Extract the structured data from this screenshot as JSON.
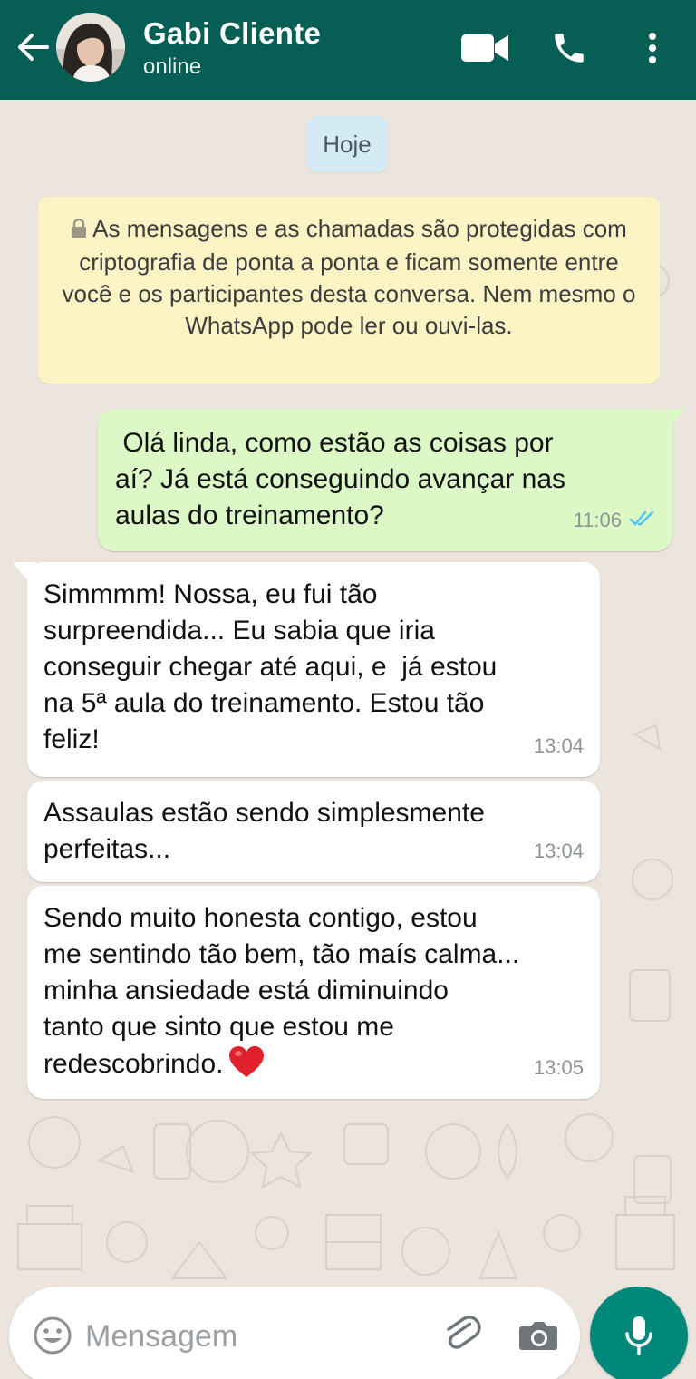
{
  "header": {
    "contact_name": "Gabi Cliente",
    "status": "online",
    "back_icon": "arrow-left-icon",
    "video_icon": "video-call-icon",
    "phone_icon": "phone-icon",
    "menu_icon": "more-vertical-icon",
    "background_color": "#075e54"
  },
  "chat": {
    "date_label": "Hoje",
    "encryption_notice": "As mensagens e as chamadas são protegidas com criptografia de ponta a ponta e ficam somente entre você e os participantes desta conversa. Nem mesmo o WhatsApp pode ler ou ouvi-las.",
    "messages": [
      {
        "direction": "outgoing",
        "text": " Olá linda, como estão as coisas por\naí? Já está conseguindo avançar nas\naulas do treinamento?",
        "time": "11:06",
        "status": "read",
        "color": "#dcf8c6"
      },
      {
        "direction": "incoming",
        "text": "Simmmm! Nossa, eu fui tão\nsurpreendida... Eu sabia que iria\nconseguir chegar até aqui, e  já estou\nna 5ª aula do treinamento. Estou tão\nfeliz!",
        "time": "13:04",
        "color": "#ffffff"
      },
      {
        "direction": "incoming",
        "text": "Assaulas estão sendo simplesmente\nperfeitas...",
        "time": "13:04",
        "color": "#ffffff"
      },
      {
        "direction": "incoming",
        "text": "Sendo muito honesta contigo, estou\nme sentindo tão bem, tão maís calma...\nminha ansiedade está diminuindo\ntanto que sinto que estou me\nredescobrindo.",
        "emoji": "red-heart-icon",
        "time": "13:05",
        "color": "#ffffff"
      }
    ]
  },
  "composer": {
    "placeholder": "Mensagem",
    "emoji_icon": "emoji-icon",
    "attach_icon": "paperclip-icon",
    "camera_icon": "camera-icon",
    "mic_icon": "microphone-icon",
    "mic_button_color": "#00897b"
  }
}
